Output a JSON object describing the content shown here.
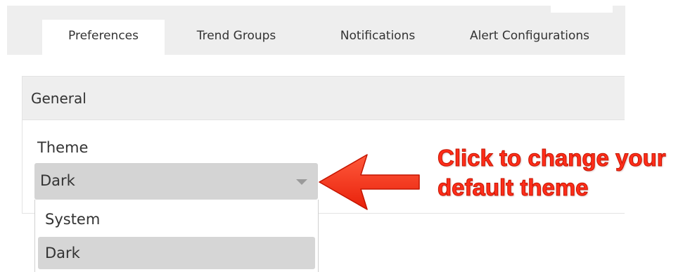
{
  "tabs": [
    {
      "label": "Preferences",
      "active": true
    },
    {
      "label": "Trend Groups",
      "active": false
    },
    {
      "label": "Notifications",
      "active": false
    },
    {
      "label": "Alert Configurations",
      "active": false
    }
  ],
  "panel": {
    "title": "General"
  },
  "theme_field": {
    "label": "Theme",
    "selected": "Dark",
    "options": [
      "System",
      "Dark"
    ],
    "highlighted_option": "Dark"
  },
  "annotation": {
    "line1": "Click to change your",
    "line2": "default theme",
    "color": "#ff2d1a"
  },
  "icons": {
    "caret": "chevron-down-icon",
    "arrow": "arrow-left-icon"
  }
}
